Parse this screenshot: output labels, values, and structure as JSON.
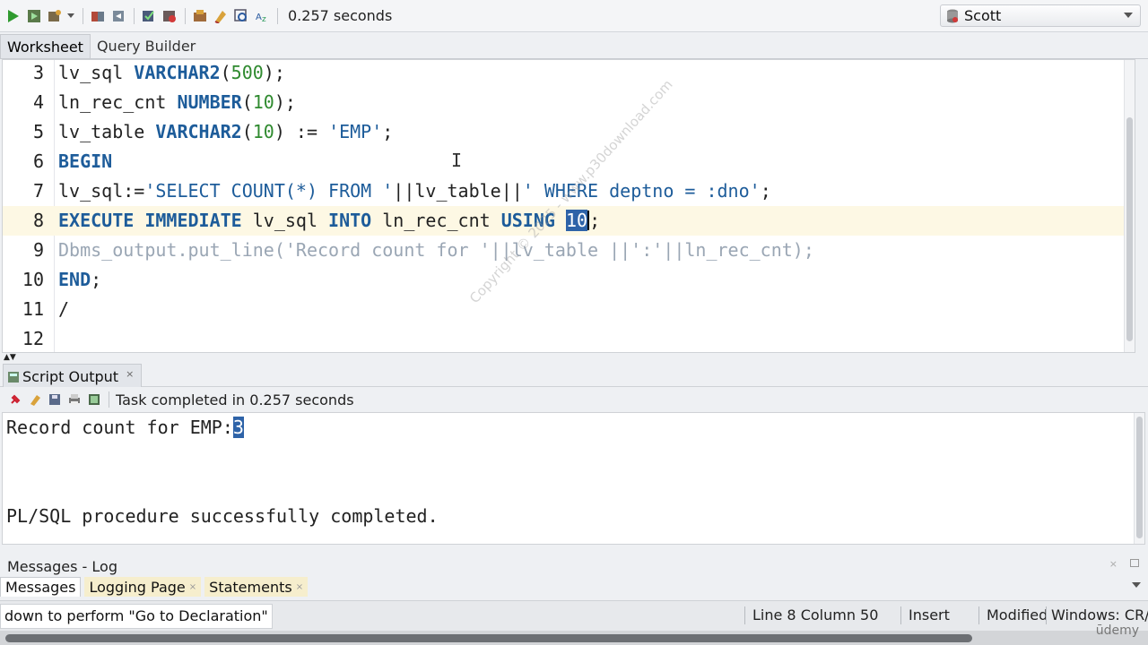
{
  "toolbar": {
    "execution_time": "0.257 seconds",
    "icons": [
      "run-statement-icon",
      "run-script-icon",
      "autotrace-icon",
      "dropdown-icon",
      "commit-icon",
      "rollback-icon",
      "explain-plan-icon",
      "tuning-advisor-icon",
      "sql-history-icon",
      "format-icon",
      "clear-icon",
      "find-icon",
      "unshared-worksheet-icon"
    ]
  },
  "connection": {
    "label": "Scott"
  },
  "worksheet_tabs": [
    "Worksheet",
    "Query Builder"
  ],
  "editor": {
    "cursor_symbol": "I",
    "lines": [
      {
        "num": "3",
        "tokens": [
          {
            "t": "lv_sql ",
            "c": "plain"
          },
          {
            "t": "VARCHAR2",
            "c": "kw"
          },
          {
            "t": "(",
            "c": "plain"
          },
          {
            "t": "500",
            "c": "num"
          },
          {
            "t": ");",
            "c": "plain"
          }
        ]
      },
      {
        "num": "4",
        "tokens": [
          {
            "t": "ln_rec_cnt ",
            "c": "plain"
          },
          {
            "t": "NUMBER",
            "c": "kw"
          },
          {
            "t": "(",
            "c": "plain"
          },
          {
            "t": "10",
            "c": "num"
          },
          {
            "t": ");",
            "c": "plain"
          }
        ]
      },
      {
        "num": "5",
        "tokens": [
          {
            "t": "lv_table ",
            "c": "plain"
          },
          {
            "t": "VARCHAR2",
            "c": "kw"
          },
          {
            "t": "(",
            "c": "plain"
          },
          {
            "t": "10",
            "c": "num"
          },
          {
            "t": ") := ",
            "c": "plain"
          },
          {
            "t": "'EMP'",
            "c": "str"
          },
          {
            "t": ";",
            "c": "plain"
          }
        ]
      },
      {
        "num": "6",
        "tokens": [
          {
            "t": "BEGIN",
            "c": "kw"
          }
        ]
      },
      {
        "num": "7",
        "tokens": [
          {
            "t": "lv_sql:=",
            "c": "plain"
          },
          {
            "t": "'SELECT COUNT(*) FROM '",
            "c": "str"
          },
          {
            "t": "||lv_table||",
            "c": "plain"
          },
          {
            "t": "' WHERE deptno = :dno'",
            "c": "str"
          },
          {
            "t": ";",
            "c": "plain"
          }
        ]
      },
      {
        "num": "8",
        "current": true,
        "tokens": [
          {
            "t": "EXECUTE IMMEDIATE ",
            "c": "kw"
          },
          {
            "t": "lv_sql ",
            "c": "plain"
          },
          {
            "t": "INTO ",
            "c": "kw"
          },
          {
            "t": "ln_rec_cnt ",
            "c": "plain"
          },
          {
            "t": "USING ",
            "c": "kw"
          },
          {
            "t": "10",
            "c": "sel"
          },
          {
            "t": "|",
            "c": "caret"
          },
          {
            "t": ";",
            "c": "plain"
          }
        ]
      },
      {
        "num": "9",
        "tokens": [
          {
            "t": "Dbms_output.put_line('Record count for '||lv_table ||':'||ln_rec_cnt);",
            "c": "muted"
          }
        ]
      },
      {
        "num": "10",
        "tokens": [
          {
            "t": "END",
            "c": "kw"
          },
          {
            "t": ";",
            "c": "plain"
          }
        ]
      },
      {
        "num": "11",
        "tokens": [
          {
            "t": "/",
            "c": "plain"
          }
        ]
      },
      {
        "num": "12",
        "tokens": []
      }
    ]
  },
  "script_output": {
    "tab_label": "Script Output",
    "close_symbol": "×",
    "task_text": "Task completed in 0.257 seconds",
    "lines": [
      {
        "prefix": "Record count for EMP:",
        "selected": "3"
      },
      {
        "prefix": "",
        "selected": ""
      },
      {
        "prefix": "",
        "selected": ""
      },
      {
        "prefix": "PL/SQL procedure successfully completed.",
        "selected": ""
      }
    ]
  },
  "messages": {
    "title": "Messages - Log",
    "close_symbol": "×",
    "tabs": [
      {
        "label": "Messages",
        "active": true,
        "closable": false
      },
      {
        "label": "Logging Page",
        "active": false,
        "closable": true
      },
      {
        "label": "Statements",
        "active": false,
        "closable": true
      }
    ],
    "tab_close_symbol": "×"
  },
  "status_bar": {
    "hint": "down to perform \"Go to Declaration\"",
    "position": "Line 8 Column 50",
    "mode": "Insert",
    "modified": "Modified",
    "encoding": "Windows: CR/"
  },
  "watermark": "Copyright © 2025 - www.p30download.com",
  "brand": "ūdemy",
  "colors": {
    "keyword": "#1d5c9a",
    "number": "#2f8a2f",
    "selection": "#2e63a8",
    "current_line": "#fdf8e4",
    "muted": "#9aa6b4"
  }
}
